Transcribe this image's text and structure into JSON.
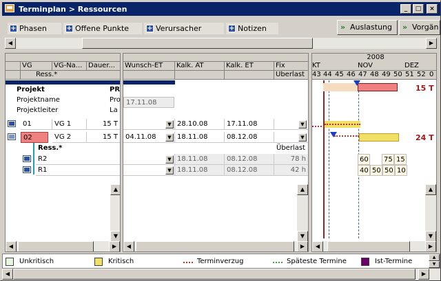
{
  "window": {
    "title": "Terminplan > Ressourcen",
    "min": "_",
    "max": "□",
    "close": "×"
  },
  "toolbar": {
    "tabs": [
      "Phasen",
      "Offene Punkte",
      "Verursacher",
      "Notizen"
    ],
    "nav": [
      "Auslastung",
      "Vorgän"
    ]
  },
  "left_headers": {
    "vg": "VG",
    "vg_name": "VG-Na...",
    "dauer": "Dauer...",
    "ress": "Ress.*"
  },
  "project_info": {
    "project_label": "Projekt",
    "project_value": "PR",
    "name_label": "Projektname",
    "name_value": "Pro",
    "lead_label": "Projektleiter",
    "lead_value": "La"
  },
  "mid_headers": {
    "wunsch": "Wunsch-ET",
    "kalk_at": "Kalk. AT",
    "kalk_et": "Kalk. ET",
    "fix": "Fix",
    "ueberlast": "Überlast"
  },
  "project_date": "17.11.08",
  "rows": [
    {
      "vg": "01",
      "name": "VG 1",
      "dauer": "15 T",
      "wunsch": "",
      "kalk_at": "28.10.08",
      "kalk_et": "17.11.08",
      "fix": ""
    },
    {
      "vg": "02",
      "name": "VG 2",
      "dauer": "15 T",
      "wunsch": "04.11.08",
      "kalk_at": "18.11.08",
      "kalk_et": "08.12.08",
      "fix": ""
    }
  ],
  "res_header": {
    "label": "Ress.*",
    "ueberlast": "Überlast"
  },
  "resources": [
    {
      "name": "R2",
      "kalk_at": "18.11.08",
      "kalk_et": "08.12.08",
      "ueberlast": "78 h",
      "loads": [
        "60",
        "75",
        "15"
      ]
    },
    {
      "name": "R1",
      "kalk_at": "18.11.08",
      "kalk_et": "08.12.08",
      "ueberlast": "42 h",
      "loads": [
        "40",
        "50",
        "50",
        "10"
      ]
    }
  ],
  "gantt": {
    "year": "2008",
    "months": [
      "KT",
      "NOV",
      "DEZ"
    ],
    "weeks": [
      "43",
      "44",
      "45",
      "46",
      "47",
      "48",
      "49",
      "50",
      "51",
      "52",
      "0"
    ],
    "proj_label": "15 T",
    "vg2_label": "24 T"
  },
  "legend": [
    "Unkritisch",
    "Kritisch",
    "Terminverzug",
    "Späteste Termine",
    "Ist-Termine"
  ],
  "colors": {
    "title_bar": "#0a246a",
    "critical": "#f0e068",
    "selected_row": "#f08080",
    "delay": "#c03030",
    "project_bar": "#f5dcc0",
    "latest": "#40a040",
    "actual": "#6a006a"
  }
}
